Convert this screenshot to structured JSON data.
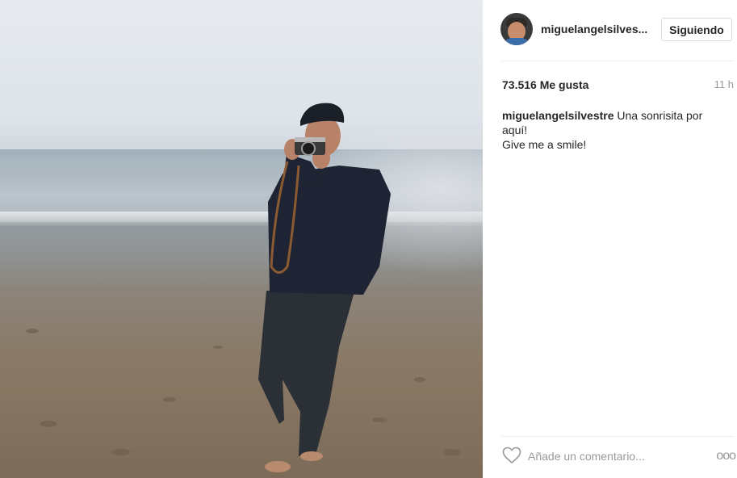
{
  "post": {
    "username": "miguelangelsilves...",
    "follow_label": "Siguiendo",
    "likes": "73.516 Me gusta",
    "time_ago": "11 h",
    "caption": {
      "author": "miguelangelsilvestre",
      "text_line1": "Una sonrisita por",
      "text_line2": "aquí!",
      "text_line3": "Give me a smile!"
    },
    "comment_placeholder": "Añade un comentario...",
    "more_label": "ooo"
  },
  "icons": {
    "like": "heart-outline-icon",
    "more": "more-options-icon"
  },
  "colors": {
    "text": "#262626",
    "muted": "#999999",
    "border": "#dbdbdb"
  }
}
